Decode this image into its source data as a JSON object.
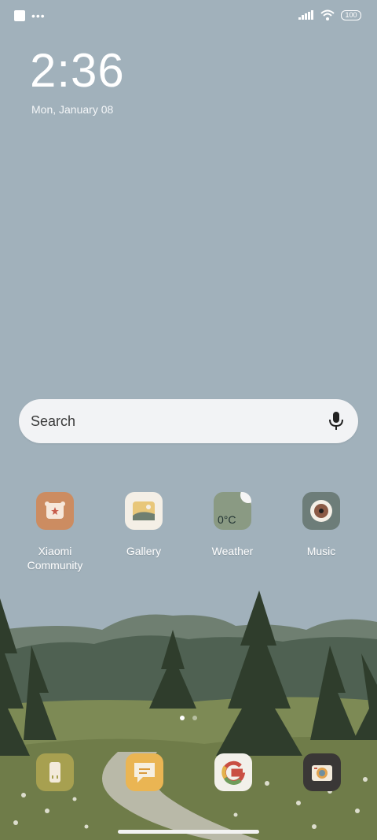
{
  "status": {
    "battery": "100",
    "dots": "•••"
  },
  "lockscreen": {
    "time": "2:36",
    "date": "Mon, January 08"
  },
  "search": {
    "placeholder": "Search"
  },
  "apps": [
    {
      "label": "Xiaomi Community",
      "icon": "xiaomi-community-icon"
    },
    {
      "label": "Gallery",
      "icon": "gallery-icon"
    },
    {
      "label": "Weather",
      "icon": "weather-icon",
      "temp": "0°C"
    },
    {
      "label": "Music",
      "icon": "music-icon"
    }
  ],
  "dock": [
    {
      "icon": "phone-icon"
    },
    {
      "icon": "messages-icon"
    },
    {
      "icon": "google-icon",
      "letter": "G"
    },
    {
      "icon": "camera-icon"
    }
  ],
  "pager": {
    "pages": 2,
    "active": 1
  },
  "colors": {
    "sky": "#a1b1bb",
    "accent_orange": "#cc8c61",
    "pill": "#f2f3f5"
  }
}
